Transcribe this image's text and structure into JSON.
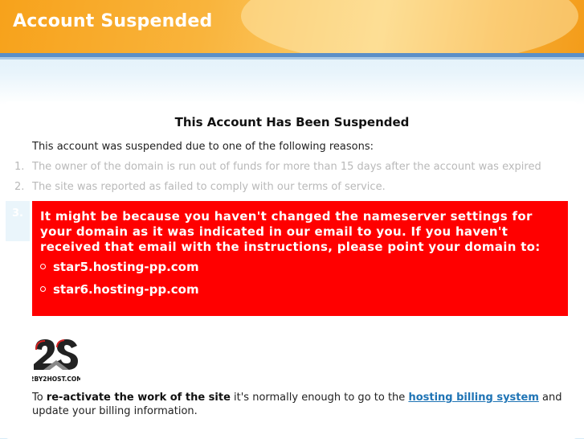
{
  "header": {
    "title": "Account Suspended"
  },
  "main": {
    "title": "This Account Has Been Suspended",
    "intro": "This account was suspended due to one of the following reasons:",
    "reasons": [
      {
        "num": "1.",
        "text": "The owner of the domain is run out of funds for more than 15 days after the account was expired"
      },
      {
        "num": "2.",
        "text": "The site was reported as failed to comply with our terms of service."
      },
      {
        "num": "3."
      }
    ]
  },
  "alert": {
    "message": "It might be because you haven't changed the nameserver settings for your domain as it was indicated in our email to you. If you haven't received that email with the instructions, please point your domain to:",
    "nameservers": [
      "star5.hosting-pp.com",
      "star6.hosting-pp.com"
    ]
  },
  "logo": {
    "text": "2BY2HOST.COM"
  },
  "footer": {
    "prefix": "To ",
    "bold": "re-activate the work of the site",
    "middle": " it's normally enough to go to the ",
    "link": "hosting billing system",
    "suffix": " and update your billing information."
  },
  "colors": {
    "header_orange": "#f7a21b",
    "stripe_blue": "#5b8fc7",
    "alert_red": "#ff0000",
    "link_blue": "#1f74b5"
  }
}
